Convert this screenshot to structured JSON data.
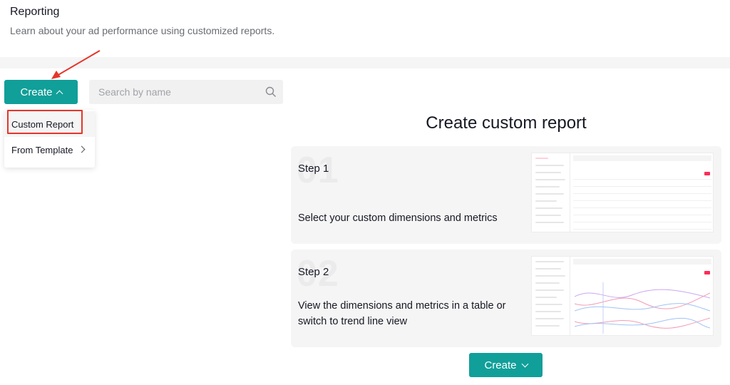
{
  "header": {
    "title": "Reporting",
    "subtitle": "Learn about your ad performance using customized reports."
  },
  "toolbar": {
    "create_label": "Create",
    "search_placeholder": "Search by name"
  },
  "create_menu": {
    "items": [
      {
        "label": "Custom Report"
      },
      {
        "label": "From Template"
      }
    ]
  },
  "main": {
    "title": "Create custom report",
    "steps": [
      {
        "number": "01",
        "label": "Step 1",
        "description": "Select your custom dimensions and metrics"
      },
      {
        "number": "02",
        "label": "Step 2",
        "description": "View the dimensions and metrics in a table or switch to trend line view"
      }
    ],
    "create_label": "Create"
  },
  "colors": {
    "accent": "#119f99",
    "highlight": "#e5362b",
    "brand_pink": "#fe2c55"
  },
  "icons": [
    "chevron-up-icon",
    "search-icon",
    "chevron-right-icon",
    "chevron-down-icon",
    "annotation-arrow-icon"
  ]
}
